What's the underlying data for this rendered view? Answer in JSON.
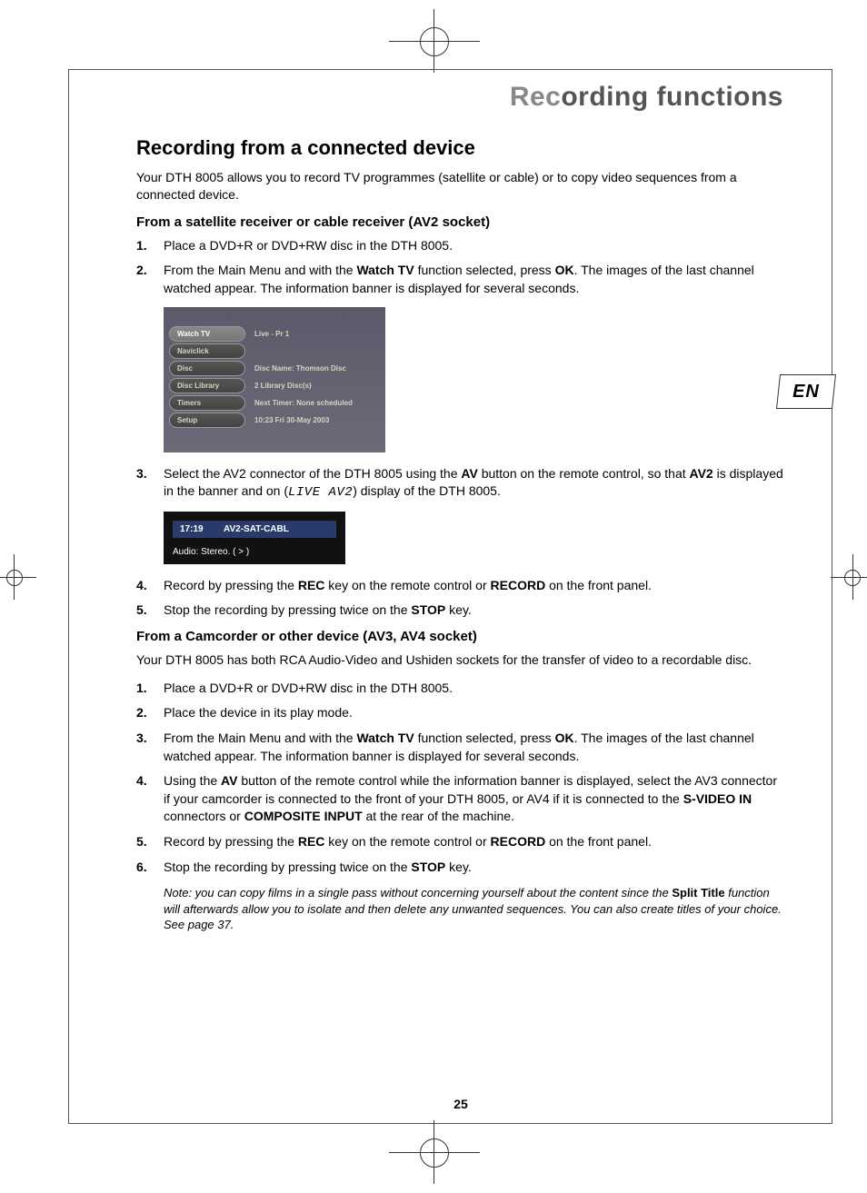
{
  "page_title_faded": "Rec",
  "page_title_bold": "ording functions",
  "lang_tab": "EN",
  "section_heading": "Recording from a connected device",
  "intro": "Your DTH 8005 allows you to record TV programmes (satellite or cable) or to copy video sequences from a connected device.",
  "sub1": "From a satellite receiver or cable receiver (AV2 socket)",
  "s1_1": "Place a DVD+R or DVD+RW disc in the DTH 8005.",
  "s1_2a": "From the Main Menu and with the ",
  "s1_2b": "Watch TV",
  "s1_2c": " function selected, press ",
  "s1_2d": "OK",
  "s1_2e": ". The images of the last channel watched appear. The information banner is displayed for several seconds.",
  "menu": {
    "items": [
      {
        "label": "Watch TV",
        "val": "Live - Pr 1"
      },
      {
        "label": "Naviclick",
        "val": ""
      },
      {
        "label": "Disc",
        "val": "Disc Name: Thomson Disc"
      },
      {
        "label": "Disc Library",
        "val": "2 Library Disc(s)"
      },
      {
        "label": "Timers",
        "val": "Next Timer: None scheduled"
      },
      {
        "label": "Setup",
        "val": "10:23 Fri 30-May 2003"
      }
    ]
  },
  "s1_3a": "Select the AV2 connector of the DTH 8005 using the ",
  "s1_3b": "AV",
  "s1_3c": " button on the remote control, so that ",
  "s1_3d": "AV2",
  "s1_3e": " is displayed in the banner and on  (",
  "s1_3f": "LIVE AV2",
  "s1_3g": ") display of the DTH 8005.",
  "banner": {
    "time": "17:19",
    "channel": "AV2-SAT-CABL",
    "audio": "Audio: Stereo.  ( > )"
  },
  "s1_4a": "Record by pressing the ",
  "s1_4b": "REC",
  "s1_4c": " key on the remote control or ",
  "s1_4d": "RECORD",
  "s1_4e": " on the front panel.",
  "s1_5a": "Stop the recording by pressing twice on the ",
  "s1_5b": "STOP",
  "s1_5c": " key.",
  "sub2": "From a Camcorder or other device (AV3, AV4 socket)",
  "intro2": "Your DTH 8005 has both RCA Audio-Video and Ushiden sockets for the transfer of video to a recordable disc.",
  "s2_1": "Place a DVD+R or DVD+RW disc in the DTH 8005.",
  "s2_2": "Place the device in its play mode.",
  "s2_3a": "From the Main Menu and with the ",
  "s2_3b": "Watch TV",
  "s2_3c": " function selected, press ",
  "s2_3d": "OK",
  "s2_3e": ". The images of the last channel watched appear. The information banner is displayed for several seconds.",
  "s2_4a": "Using the ",
  "s2_4b": "AV",
  "s2_4c": " button of the remote control while the information banner is displayed, select the AV3 connector if your camcorder is connected to the front of your DTH 8005, or AV4 if it is connected to the ",
  "s2_4d": "S-VIDEO IN",
  "s2_4e": " connectors or ",
  "s2_4f": "COMPOSITE INPUT",
  "s2_4g": " at the rear of the machine.",
  "s2_5a": "Record by pressing the ",
  "s2_5b": "REC",
  "s2_5c": " key on the remote control or ",
  "s2_5d": "RECORD",
  "s2_5e": " on the front panel.",
  "s2_6a": "Stop the recording by pressing twice on the ",
  "s2_6b": "STOP",
  "s2_6c": " key.",
  "note_a": "Note: you can copy films in a single pass without concerning yourself about the content since the ",
  "note_b": "Split Title",
  "note_c": " function will afterwards allow you to isolate and then delete any unwanted sequences. You can also create titles of your choice. See page 37.",
  "page_number": "25"
}
